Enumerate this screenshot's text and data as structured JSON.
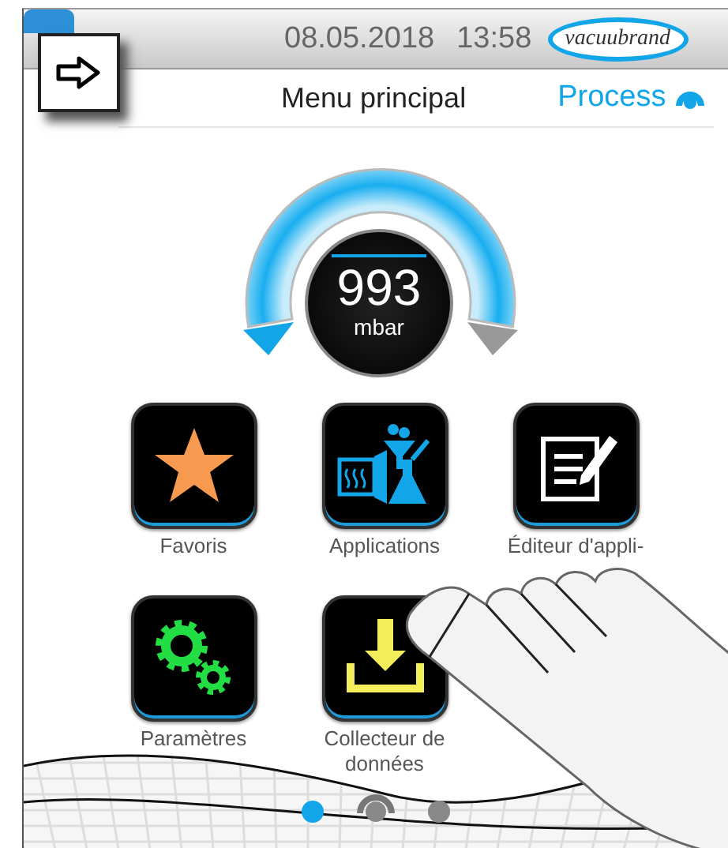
{
  "header": {
    "date": "08.05.2018",
    "time": "13:58",
    "logo": "vacuubrand"
  },
  "title": "Menu principal",
  "process": {
    "label": "Process"
  },
  "gauge": {
    "value": "993",
    "unit": "mbar"
  },
  "tiles": [
    {
      "kind": "star",
      "label": "Favoris"
    },
    {
      "kind": "applications",
      "label": "Applications"
    },
    {
      "kind": "editor",
      "label": "Éditeur d'appli-"
    },
    {
      "kind": "settings",
      "label": "Paramètres"
    },
    {
      "kind": "download",
      "label": "Collecteur de données"
    }
  ],
  "pages": [
    {
      "kind": "dot",
      "selected": true
    },
    {
      "kind": "home",
      "selected": false
    },
    {
      "kind": "dot",
      "selected": false
    }
  ]
}
